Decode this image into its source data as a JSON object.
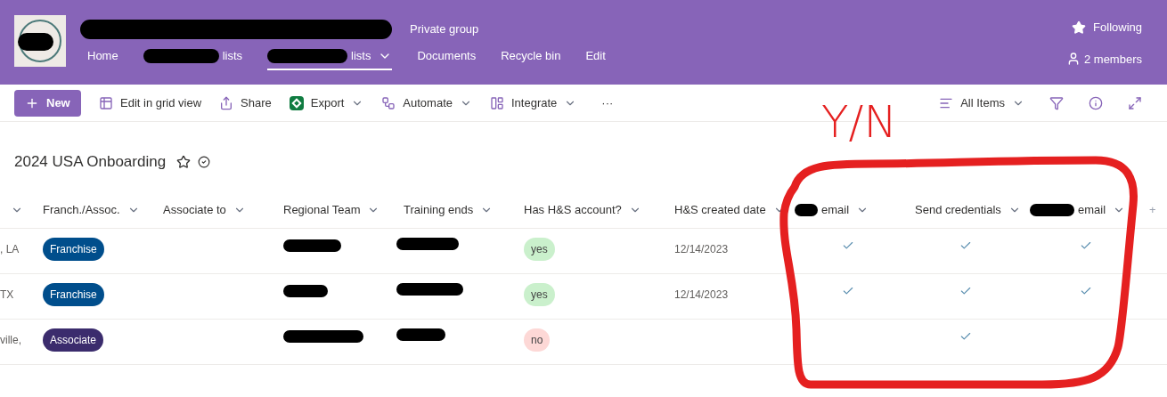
{
  "site": {
    "visibility": "Private group",
    "following": "Following",
    "members": "2 members",
    "nav": [
      {
        "label": "Home",
        "redacted": false,
        "selected": false,
        "dropdown": false
      },
      {
        "label": "lists",
        "redacted": true,
        "selected": false,
        "dropdown": false
      },
      {
        "label": "lists",
        "redacted": true,
        "selected": true,
        "dropdown": true
      },
      {
        "label": "Documents",
        "redacted": false,
        "selected": false,
        "dropdown": false
      },
      {
        "label": "Recycle bin",
        "redacted": false,
        "selected": false,
        "dropdown": false
      },
      {
        "label": "Edit",
        "redacted": false,
        "selected": false,
        "dropdown": false
      }
    ]
  },
  "command_bar": {
    "new": "New",
    "items": [
      {
        "label": "Edit in grid view",
        "kind": "grid",
        "dropdown": false
      },
      {
        "label": "Share",
        "kind": "share",
        "dropdown": false
      },
      {
        "label": "Export",
        "kind": "excel",
        "dropdown": true
      },
      {
        "label": "Automate",
        "kind": "automate",
        "dropdown": true
      },
      {
        "label": "Integrate",
        "kind": "integrate",
        "dropdown": true
      }
    ],
    "more": "···",
    "view": "All Items"
  },
  "list_title": "2024 USA Onboarding",
  "table": {
    "columns": [
      {
        "redacted": false
      },
      {
        "label": "Franch./Assoc.",
        "redacted": false
      },
      {
        "label": "Associate to",
        "redacted": false
      },
      {
        "label": "Regional Team",
        "redacted": false
      },
      {
        "label": "Training ends",
        "redacted": false
      },
      {
        "label": "Has H&S account?",
        "redacted": false
      },
      {
        "label": "H&S created date",
        "redacted": false
      },
      {
        "label": "email",
        "redacted": true
      },
      {
        "label": "Send credentials",
        "redacted": false
      },
      {
        "label": "email",
        "redacted": true
      }
    ],
    "add_column": "+",
    "rows": [
      {
        "column_1": ", LA",
        "type": {
          "label": "Franchise",
          "color": "#004e8c"
        },
        "has_account": {
          "label": "yes",
          "color": "#caf0cc"
        },
        "created": "12/14/2023",
        "checks": [
          true,
          true,
          true
        ]
      },
      {
        "column_1": "TX",
        "type": {
          "label": "Franchise",
          "color": "#004e8c"
        },
        "has_account": {
          "label": "yes",
          "color": "#caf0cc"
        },
        "created": "12/14/2023",
        "checks": [
          true,
          true,
          true
        ]
      },
      {
        "column_1": "ville,",
        "type": {
          "label": "Associate",
          "color": "#3b2c6d"
        },
        "has_account": {
          "label": "no",
          "color": "#fdd8d6"
        },
        "checks": [
          false,
          true,
          false
        ]
      }
    ]
  },
  "annotation": {
    "label": "Y/N"
  }
}
